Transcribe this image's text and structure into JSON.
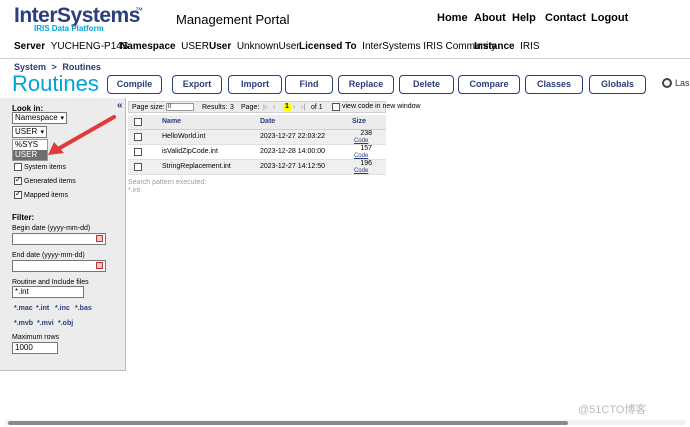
{
  "header": {
    "logo_main": "InterSystems",
    "logo_tm": "™",
    "logo_sub": "IRIS Data Platform",
    "portal_title": "Management Portal",
    "nav": [
      "Home",
      "About",
      "Help",
      "Contact",
      "Logout"
    ]
  },
  "info": {
    "server_label": "Server",
    "server": "YUCHENG-P14S",
    "namespace_label": "Namespace",
    "namespace": "USER",
    "user_label": "User",
    "user": "UnknownUser",
    "licensed_label": "Licensed To",
    "licensed": "InterSystems IRIS Community",
    "instance_label": "Instance",
    "instance": "IRIS"
  },
  "breadcrumb": [
    "System",
    ">",
    "Routines"
  ],
  "page_title": "Routines",
  "toolbar": [
    "Compile",
    "Export",
    "Import",
    "Find",
    "Replace",
    "Delete",
    "Compare",
    "Classes",
    "Globals"
  ],
  "last_tool": "Las",
  "left": {
    "collapse": "«",
    "look_in": "Look in:",
    "lookin_type": "Namespace",
    "namespace_value": "USER",
    "dropdown_options": [
      "%SYS",
      "USER"
    ],
    "checkboxes": [
      {
        "label": "System items",
        "checked": false
      },
      {
        "label": "Generated items",
        "checked": true
      },
      {
        "label": "Mapped items",
        "checked": true
      }
    ],
    "filter_label": "Filter:",
    "begin_label": "Begin date (yyyy-mm-dd)",
    "begin_value": "",
    "end_label": "End date (yyyy-mm-dd)",
    "end_value": "",
    "routine_label": "Routine and Include files",
    "routine_value": "*.int",
    "ext_row1": [
      "*.mac",
      "*.int",
      "*.inc",
      "*.bas"
    ],
    "ext_row2": [
      "*.mvb",
      "*.mvi",
      "*.obj"
    ],
    "max_rows_label": "Maximum rows",
    "max_rows_value": "1000"
  },
  "pager": {
    "page_size_label": "Page size:",
    "page_size": "0",
    "results_label": "Results:",
    "results": "3",
    "page_label": "Page:",
    "current": "1",
    "of_label": "of 1",
    "view_code_label": "view code in new window"
  },
  "table": {
    "headers": [
      "Name",
      "Date",
      "Size"
    ],
    "rows": [
      {
        "name": "HelloWorld.int",
        "date": "2023-12-27 22:03:22",
        "size": "238",
        "action": "Code"
      },
      {
        "name": "isValidZipCode.int",
        "date": "2023-12-28 14:00:00",
        "size": "157",
        "action": "Code"
      },
      {
        "name": "StringReplacement.int",
        "date": "2023-12-27 14:12:50",
        "size": "196",
        "action": "Code"
      }
    ]
  },
  "search_note_1": "Search pattern executed:",
  "search_note_2": "*.int",
  "watermark": "@51CTO博客",
  "colors": {
    "brand_navy": "#2a3d7c",
    "brand_cyan": "#00a3d7",
    "arrow_red": "#e03a3a",
    "panel_gray": "#ececec"
  }
}
